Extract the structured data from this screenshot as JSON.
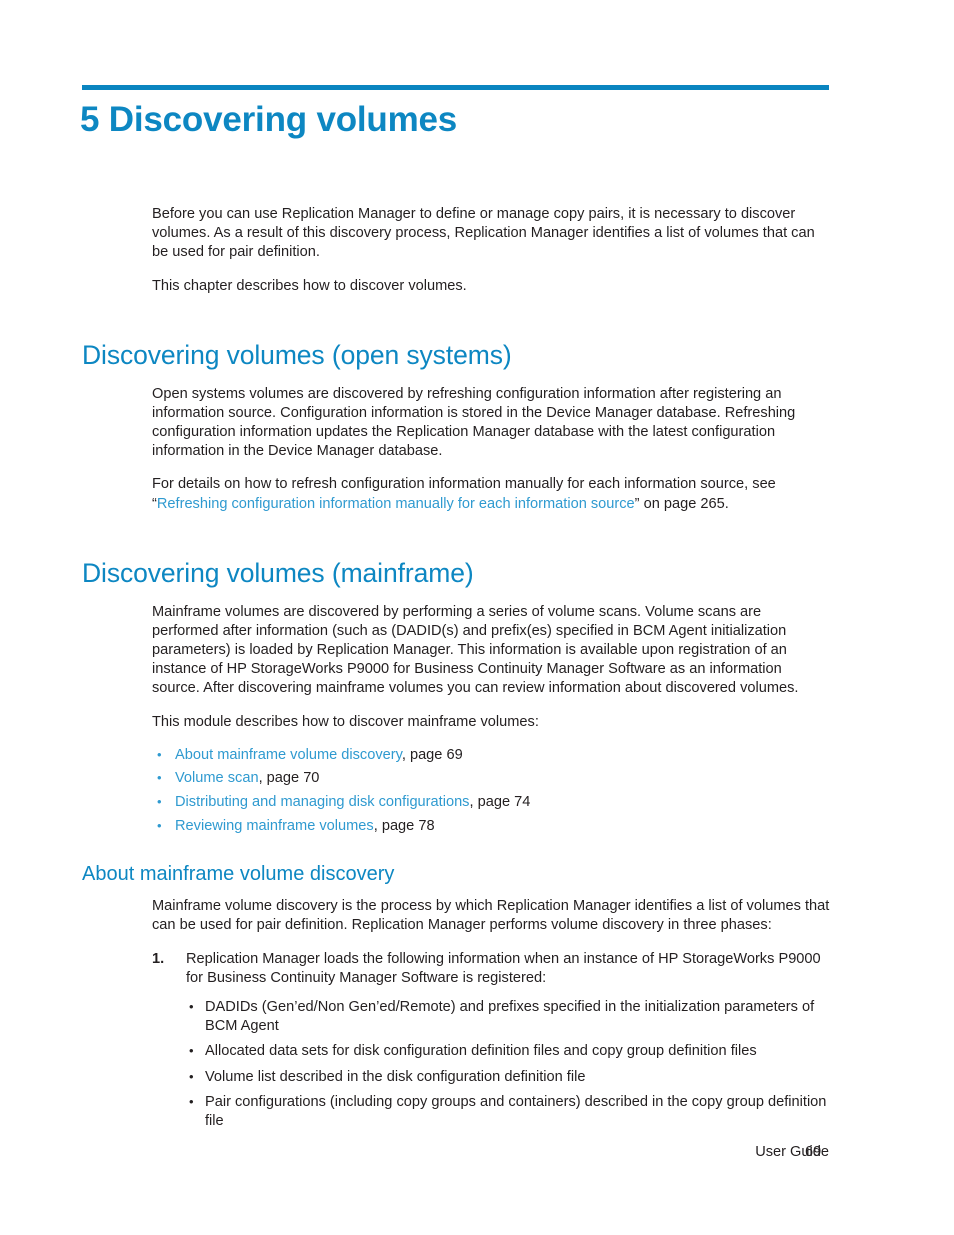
{
  "chapter": {
    "number_and_title": "5 Discovering volumes"
  },
  "intro": {
    "paragraph_1": "Before you can use Replication Manager to define or manage copy pairs, it is necessary to discover volumes. As a result of this discovery process, Replication Manager identifies a list of volumes that can be used for pair definition.",
    "paragraph_2": "This chapter describes how to discover volumes."
  },
  "open_systems": {
    "heading": "Discovering volumes (open systems)",
    "paragraph_1": "Open systems volumes are discovered by refreshing configuration information after registering an information source. Configuration information is stored in the Device Manager database. Refreshing configuration information updates the Replication Manager database with the latest configuration information in the Device Manager database.",
    "xref_lead": "For details on how to refresh configuration information manually for each information source, see “",
    "xref_link": "Refreshing configuration information manually for each information source",
    "xref_tail": "” on page 265."
  },
  "mainframe": {
    "heading": "Discovering volumes (mainframe)",
    "paragraph_1": "Mainframe volumes are discovered by performing a series of volume scans. Volume scans are performed after information (such as (DADID(s) and prefix(es) specified in BCM Agent initialization parameters) is loaded by Replication Manager. This information is available upon registration of an instance of HP StorageWorks P9000 for Business Continuity Manager Software as an information source. After discovering mainframe volumes you can review information about discovered volumes.",
    "list_lead": "This module describes how to discover mainframe volumes:",
    "links": [
      {
        "label": "About mainframe volume discovery",
        "page_text": ", page 69"
      },
      {
        "label": "Volume scan",
        "page_text": ", page 70"
      },
      {
        "label": "Distributing and managing disk configurations",
        "page_text": ", page 74"
      },
      {
        "label": "Reviewing mainframe volumes",
        "page_text": ", page 78"
      }
    ]
  },
  "about_discovery": {
    "heading": "About mainframe volume discovery",
    "paragraph_1": "Mainframe volume discovery is the process by which Replication Manager identifies a list of volumes that can be used for pair definition. Replication Manager performs volume discovery in three phases:",
    "step_1": {
      "marker": "1.",
      "text": "Replication Manager loads the following information when an instance of HP StorageWorks P9000 for Business Continuity Manager Software is registered:",
      "sub_items": [
        "DADIDs (Gen’ed/Non Gen’ed/Remote) and prefixes specified in the initialization parameters of BCM Agent",
        "Allocated data sets for disk configuration definition files and copy group definition files",
        "Volume list described in the disk configuration definition file",
        "Pair configurations (including copy groups and containers) described in the copy group definition file"
      ]
    }
  },
  "footer": {
    "label": "User Guide",
    "page_number": "69"
  },
  "colors": {
    "accent": "#0d87c2",
    "rule": "#0a85c0",
    "link": "#2f9ad0",
    "body_text": "#231f20"
  }
}
